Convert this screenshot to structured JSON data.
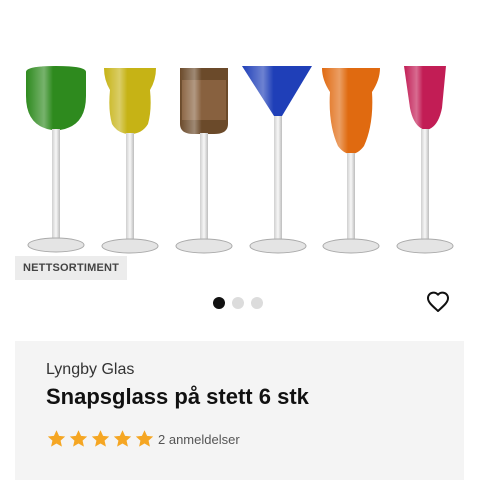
{
  "badge": {
    "label": "NETTSORTIMENT"
  },
  "carousel": {
    "count": 3,
    "active_index": 0
  },
  "product": {
    "brand": "Lyngby Glas",
    "title": "Snapsglass på stett 6 stk",
    "rating": {
      "value": 5,
      "max": 5,
      "review_text": "2 anmeldelser"
    }
  },
  "glass_colors": [
    "#2e8a1e",
    "#c6b315",
    "#6b4a2a",
    "#1f3fb8",
    "#e06a10",
    "#c21d55"
  ],
  "colors": {
    "star": "#f5a623",
    "badge_bg": "#ececec",
    "card_bg": "#f4f4f4"
  },
  "icons": {
    "wishlist": "heart-outline-icon",
    "star": "star-icon"
  }
}
